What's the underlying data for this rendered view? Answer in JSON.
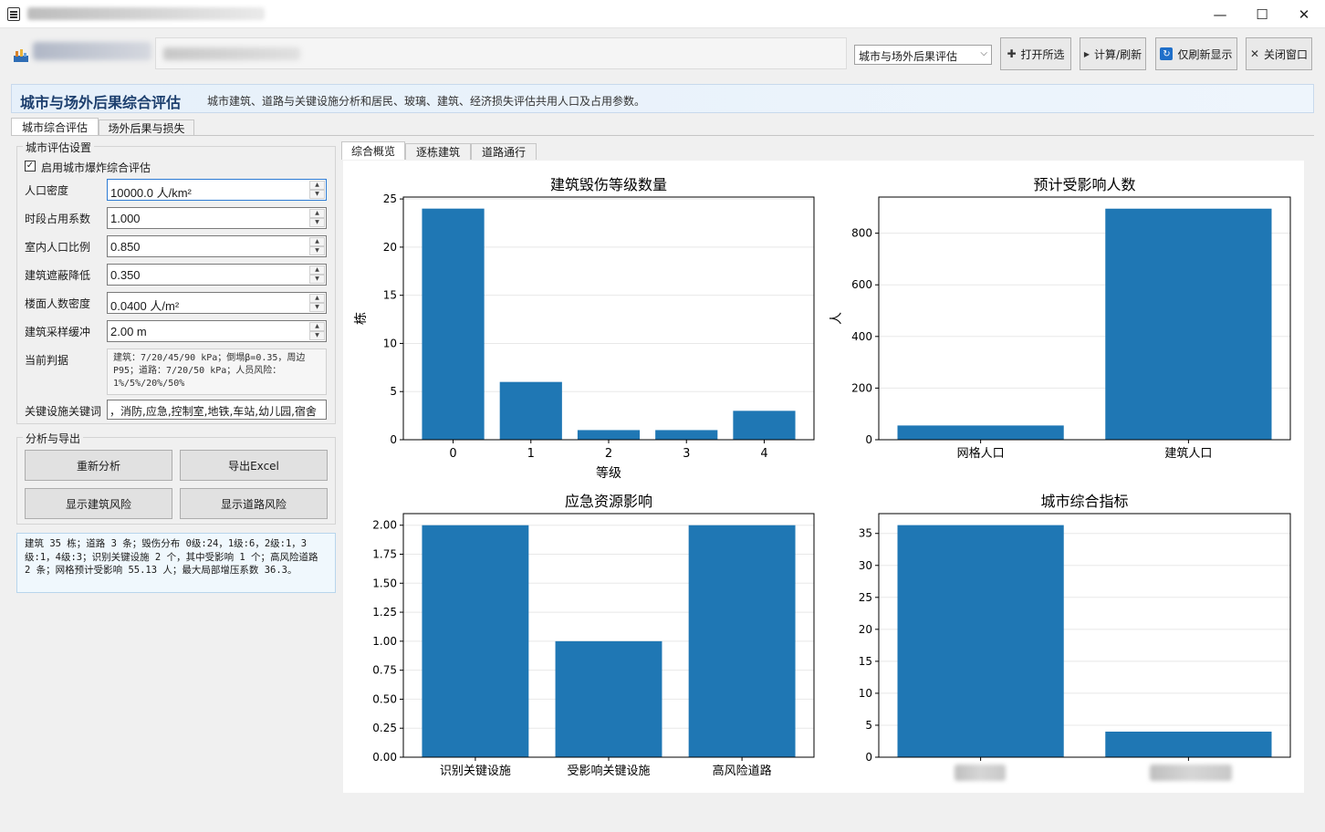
{
  "window": {
    "controls": {
      "minimize": "—",
      "maximize": "☐",
      "close": "✕"
    }
  },
  "toolbar": {
    "module_select": "城市与场外后果评估",
    "open_button": "打开所选",
    "compute_button": "计算/刷新",
    "refresh_display_button": "仅刷新显示",
    "close_button": "关闭窗口"
  },
  "header": {
    "title": "城市与场外后果综合评估",
    "description": "城市建筑、道路与关键设施分析和居民、玻璃、建筑、经济损失评估共用人口及占用参数。"
  },
  "main_tabs": [
    "城市综合评估",
    "场外后果与损失"
  ],
  "settings": {
    "group_title": "城市评估设置",
    "enable_label": "启用城市爆炸综合评估",
    "enable_checked": "✓",
    "fields": [
      {
        "label": "人口密度",
        "value": "10000.0 人/km²"
      },
      {
        "label": "时段占用系数",
        "value": "1.000"
      },
      {
        "label": "室内人口比例",
        "value": "0.850"
      },
      {
        "label": "建筑遮蔽降低",
        "value": "0.350"
      },
      {
        "label": "楼面人数密度",
        "value": "0.0400 人/m²"
      },
      {
        "label": "建筑采样缓冲",
        "value": "2.00 m"
      }
    ],
    "judge_label": "当前判据",
    "judge_text": "建筑：7/20/45/90 kPa；倒塌β=0.35，周边P95；道路：7/20/50 kPa；人员风险：1%/5%/20%/50%",
    "keywords_label": "关键设施关键词",
    "keywords_value": "，消防,应急,控制室,地铁,车站,幼儿园,宿舍"
  },
  "analysis": {
    "group_title": "分析与导出",
    "reanalyze_button": "重新分析",
    "export_button": "导出Excel",
    "show_building_risk_button": "显示建筑风险",
    "show_road_risk_button": "显示道路风险"
  },
  "summary_text": "建筑 35 栋；道路 3 条；毁伤分布 0级:24，1级:6，2级:1，3级:1，4级:3；识别关键设施 2 个，其中受影响 1 个；高风险道路 2 条；网格预计受影响 55.13 人；最大局部增压系数 36.3。",
  "sub_tabs": [
    "综合概览",
    "逐栋建筑",
    "道路通行"
  ],
  "colors": {
    "bar": "#1f77b4",
    "accent": "#2d7bd4"
  },
  "chart_data": [
    {
      "type": "bar",
      "title": "建筑毁伤等级数量",
      "categories": [
        "0",
        "1",
        "2",
        "3",
        "4"
      ],
      "values": [
        24,
        6,
        1,
        1,
        3
      ],
      "xlabel": "等级",
      "ylabel": "栋",
      "ylim": [
        0,
        25.2
      ],
      "yticks": [
        "0",
        "5",
        "10",
        "15",
        "20",
        "25"
      ],
      "grid": true
    },
    {
      "type": "bar",
      "title": "预计受影响人数",
      "categories": [
        "网格人口",
        "建筑人口"
      ],
      "values": [
        55.13,
        895
      ],
      "xlabel": "",
      "ylabel": "人",
      "ylim": [
        0,
        940
      ],
      "yticks": [
        "0",
        "200",
        "400",
        "600",
        "800"
      ],
      "grid": true
    },
    {
      "type": "bar",
      "title": "应急资源影响",
      "categories": [
        "识别关键设施",
        "受影响关键设施",
        "高风险道路"
      ],
      "values": [
        2,
        1,
        2
      ],
      "xlabel": "",
      "ylabel": "",
      "ylim": [
        0,
        2.1
      ],
      "yticks": [
        "0.00",
        "0.25",
        "0.50",
        "0.75",
        "1.00",
        "1.25",
        "1.50",
        "1.75",
        "2.00"
      ],
      "grid": true
    },
    {
      "type": "bar",
      "title": "城市综合指标",
      "categories": [
        "",
        ""
      ],
      "values": [
        36.3,
        4
      ],
      "xlabel": "",
      "ylabel": "",
      "ylim": [
        0,
        38.1
      ],
      "yticks": [
        "0",
        "5",
        "10",
        "15",
        "20",
        "25",
        "30",
        "35"
      ],
      "grid": true
    }
  ]
}
